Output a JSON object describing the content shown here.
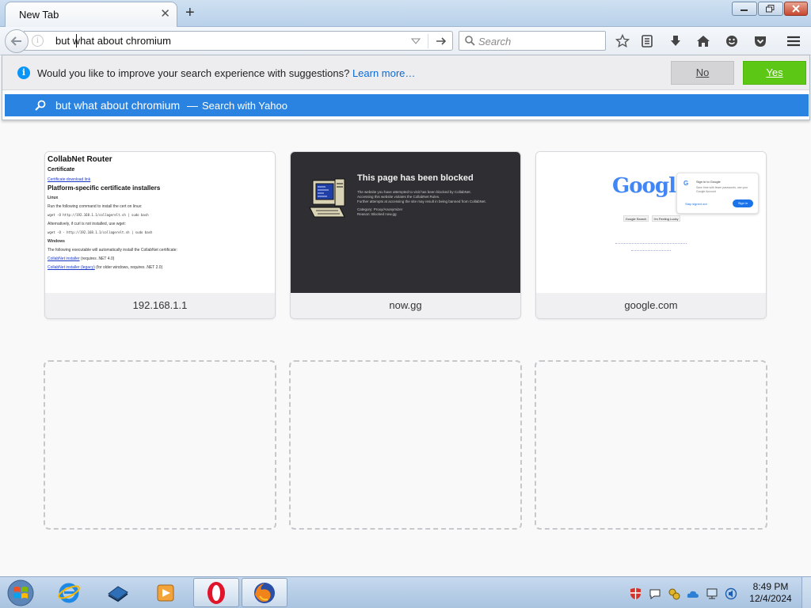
{
  "browser": {
    "tab": {
      "title": "New Tab"
    },
    "urlbar": {
      "value": "but what about chromium"
    },
    "searchbar": {
      "placeholder": "Search"
    }
  },
  "search_suggestions_prompt": {
    "question": "Would you like to improve your search experience with suggestions?",
    "learn_more": "Learn more…",
    "no_label": "No",
    "yes_label": "Yes"
  },
  "autocomplete": {
    "query": "but what about chromium",
    "separator": "—",
    "action": "Search with Yahoo"
  },
  "tiles": [
    {
      "label": "192.168.1.1",
      "thumb": {
        "title": "CollabNet Router",
        "certificate": "Certificate",
        "cert_link": "Certificate download link",
        "installers_heading": "Platform-specific certificate installers",
        "linux": "Linux",
        "linux_line1": "Run the following command to install the cert on linux:",
        "linux_cmd1": "wget -O http://192.168.1.1/collagerelt.sh | sudo bash",
        "linux_line2": "Alternatively, if curl is not installed, use wget:",
        "linux_cmd2": "wget -O - http://192.168.1.1/collagerelt.sh | sudo bash",
        "windows": "Windows",
        "windows_line": "The following executable will automatically install the CollabNet certificate:",
        "win_link1": "CollabNet installer",
        "win_link1_note": "(requires .NET 4.0)",
        "win_link2": "CollabNet installer (legacy)",
        "win_link2_note": "(for older windows, requires .NET 2.0)"
      }
    },
    {
      "label": "now.gg",
      "thumb": {
        "title": "This page has been blocked",
        "line1": "The website you have attempted to visit has been blocked by CollabNet.",
        "line2": "Accessing this website violates the CollabNet Rules.",
        "line3": "Further attempts at accessing the site may result in being banned from CollabNet.",
        "line4": "Category: Proxy/Anonymizer",
        "line5": "Reason: Blocked now.gg"
      }
    },
    {
      "label": "google.com",
      "thumb": {
        "logo": "Google",
        "signin_title": "Sign in to Google",
        "signin_text": "Save time with fewer passwords, use your Google Account",
        "stay_signed_out": "Stay signed out",
        "sign_in": "Sign in",
        "search_btn": "Google Search",
        "lucky_btn": "I'm Feeling Lucky"
      }
    }
  ],
  "empty_tiles": 3,
  "taskbar": {
    "apps": [
      "internet-explorer",
      "media-center",
      "windows-media-player",
      "opera",
      "firefox"
    ],
    "clock": {
      "time": "8:49 PM",
      "date": "12/4/2024"
    }
  },
  "colors": {
    "accent_blue": "#2a83e0",
    "yes_green": "#5cc815",
    "no_gray": "#d4d4d6",
    "info_blue": "#0996f8",
    "link_blue": "#0a6bd6"
  }
}
